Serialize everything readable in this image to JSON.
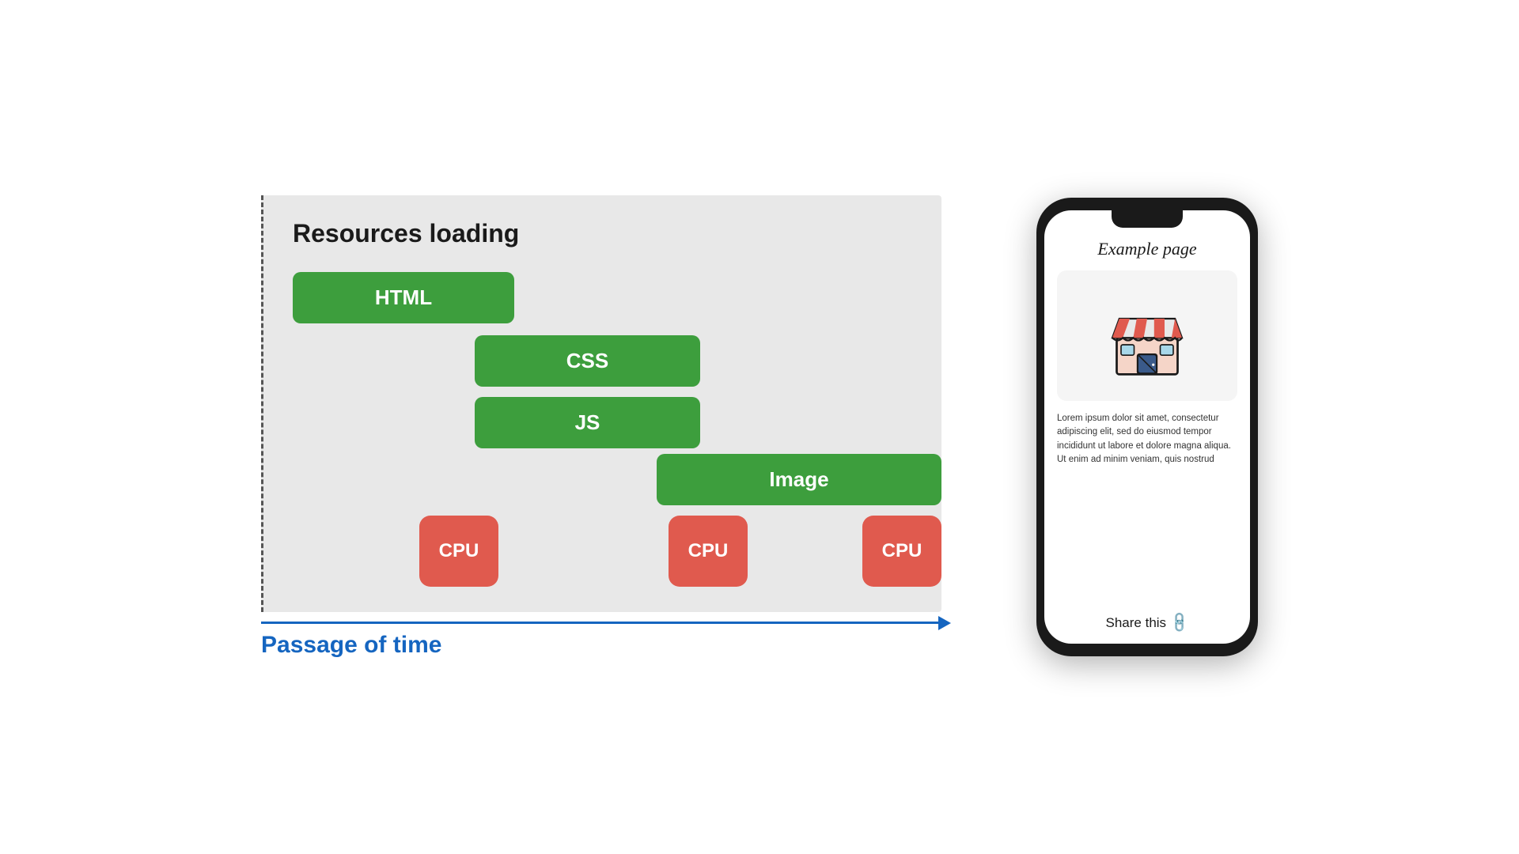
{
  "diagram": {
    "title": "Resources loading",
    "bars": {
      "html": "HTML",
      "css": "CSS",
      "js": "JS",
      "image": "Image"
    },
    "cpu_labels": [
      "CPU",
      "CPU",
      "CPU"
    ],
    "time_label": "Passage of time"
  },
  "phone": {
    "page_title": "Example page",
    "lorem_text": "Lorem ipsum dolor sit amet, consectetur adipiscing elit, sed do eiusmod tempor incididunt ut labore et dolore magna aliqua. Ut enim ad minim veniam, quis nostrud",
    "share_label": "Share this"
  },
  "colors": {
    "green": "#3d9e3d",
    "red": "#e05a4e",
    "blue": "#1565c0",
    "diagram_bg": "#e8e8e8",
    "phone_bg": "#1a1a1a"
  }
}
